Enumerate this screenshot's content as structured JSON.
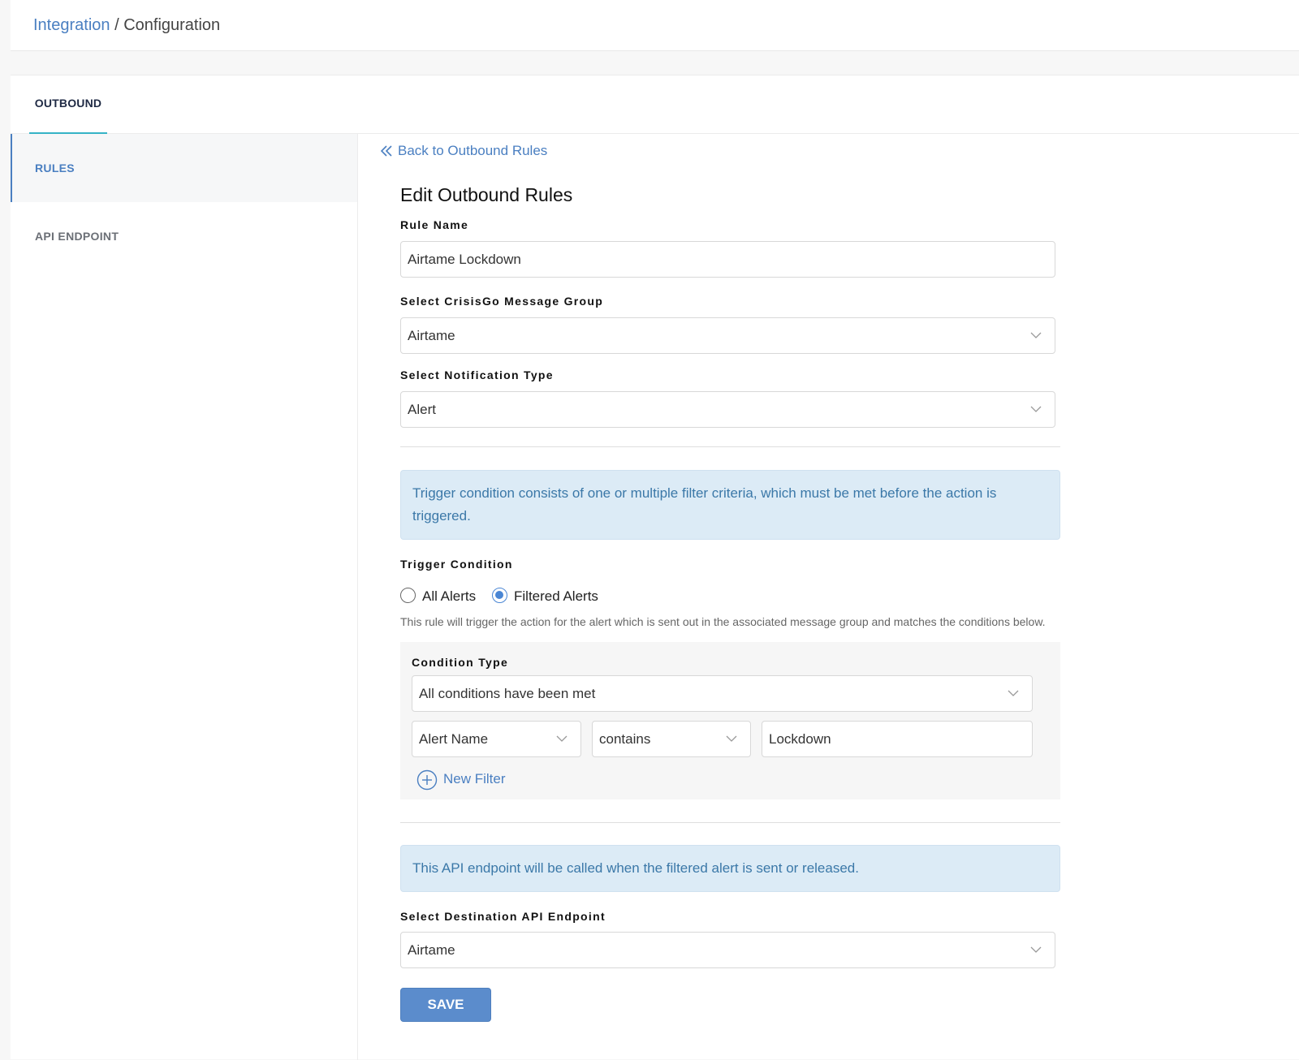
{
  "header": {
    "breadcrumb_link": "Integration",
    "breadcrumb_sep": "/",
    "breadcrumb_current": "Configuration"
  },
  "tabs": {
    "outbound": "OUTBOUND"
  },
  "sidebar": {
    "items": [
      {
        "label": "RULES",
        "active": true
      },
      {
        "label": "API ENDPOINT",
        "active": false
      }
    ]
  },
  "content": {
    "back_link": "Back to Outbound Rules",
    "title": "Edit Outbound Rules",
    "rule_name": {
      "label": "Rule Name",
      "value": "Airtame Lockdown"
    },
    "message_group": {
      "label": "Select CrisisGo Message Group",
      "value": "Airtame"
    },
    "notification_type": {
      "label": "Select Notification Type",
      "value": "Alert"
    },
    "trigger_info": "Trigger condition consists of one or multiple filter criteria, which must be met before the action is triggered.",
    "trigger_condition": {
      "label": "Trigger Condition",
      "options": [
        "All Alerts",
        "Filtered Alerts"
      ],
      "selected": "Filtered Alerts",
      "help": "This rule will trigger the action for the alert which is sent out in the associated message group and matches the conditions below."
    },
    "condition": {
      "type_label": "Condition Type",
      "type_value": "All conditions have been met",
      "field": "Alert Name",
      "operator": "contains",
      "value": "Lockdown",
      "new_filter": "New Filter"
    },
    "api_info": "This API endpoint will be called when the filtered alert is sent or released.",
    "destination": {
      "label": "Select Destination API Endpoint",
      "value": "Airtame"
    },
    "save_label": "SAVE"
  },
  "colors": {
    "accent": "#4a7fc1",
    "tab_underline": "#35b3c6",
    "info_bg": "#dcebf6",
    "info_text": "#3b78a8",
    "save_bg": "#5b8ccc"
  }
}
